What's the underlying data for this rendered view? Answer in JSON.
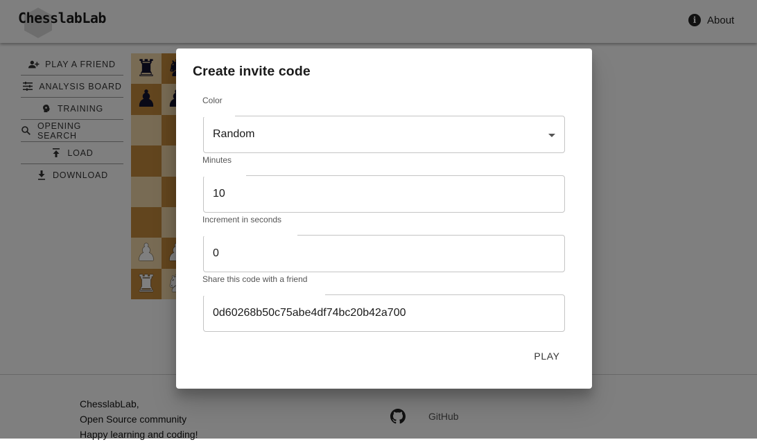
{
  "header": {
    "logo_text": "ChesslabLab",
    "about_label": "About"
  },
  "menu": {
    "items": [
      {
        "label": "PLAY A FRIEND",
        "icon": "person-add-icon"
      },
      {
        "label": "ANALYSIS BOARD",
        "icon": "tune-icon"
      },
      {
        "label": "TRAINING",
        "icon": "brain-icon"
      },
      {
        "label": "OPENING SEARCH",
        "icon": "search-icon"
      },
      {
        "label": "LOAD",
        "icon": "upload-icon"
      },
      {
        "label": "DOWNLOAD",
        "icon": "download-icon"
      }
    ]
  },
  "board": {
    "light_color": "#f1d7a8",
    "dark_color": "#c58a3c",
    "visible_pieces": [
      {
        "square": "a8",
        "piece": "black-rook"
      },
      {
        "square": "b8",
        "piece": "black-knight"
      },
      {
        "square": "a7",
        "piece": "black-pawn"
      },
      {
        "square": "b7",
        "piece": "black-pawn"
      },
      {
        "square": "a2",
        "piece": "white-pawn"
      },
      {
        "square": "b2",
        "piece": "white-pawn"
      },
      {
        "square": "a1",
        "piece": "white-rook"
      },
      {
        "square": "b1",
        "piece": "white-knight"
      }
    ]
  },
  "dialog": {
    "title": "Create invite code",
    "color_label": "Color",
    "color_value": "Random",
    "minutes_label": "Minutes",
    "minutes_value": "10",
    "increment_label": "Increment in seconds",
    "increment_value": "0",
    "share_label": "Share this code with a friend",
    "share_value": "0d60268b50c75abe4df74bc20b42a700",
    "play_label": "PLAY"
  },
  "footer": {
    "line1": "ChesslabLab,",
    "line2": "Open Source community",
    "line3": "Happy learning and coding!",
    "github_label": "GitHub"
  }
}
